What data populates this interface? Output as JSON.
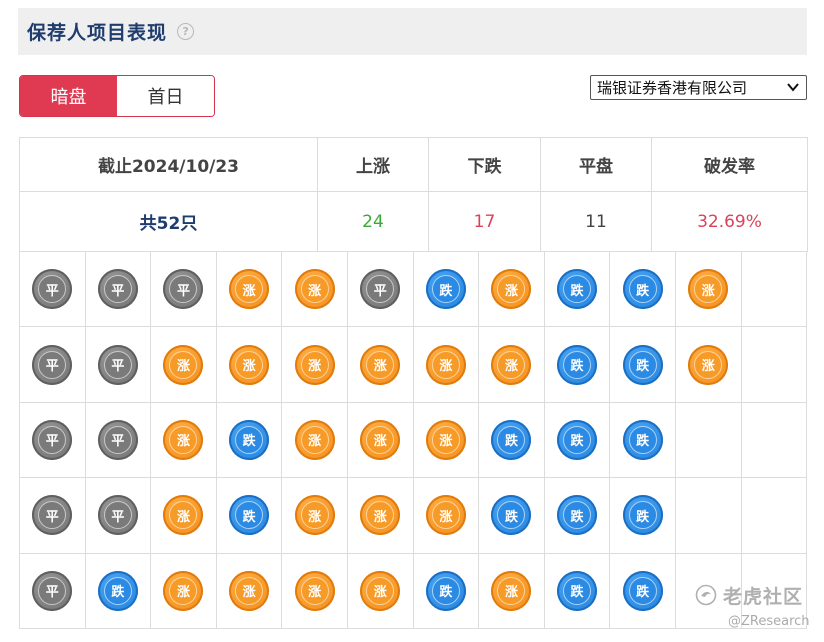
{
  "header": {
    "title": "保荐人项目表现",
    "help_symbol": "?"
  },
  "tabs": [
    {
      "label": "暗盘",
      "active": true
    },
    {
      "label": "首日",
      "active": false
    }
  ],
  "broker_select": {
    "selected": "瑞银证券香港有限公司"
  },
  "summary": {
    "headers": {
      "date": "截止2024/10/23",
      "up": "上涨",
      "down": "下跌",
      "flat": "平盘",
      "break_rate": "破发率"
    },
    "values": {
      "total": "共52只",
      "up": "24",
      "down": "17",
      "flat": "11",
      "break_rate": "32.69%"
    }
  },
  "coin_labels": {
    "flat": "平",
    "up": "涨",
    "down": "跌"
  },
  "colors": {
    "accent_red": "#e03a52",
    "up_orange": "#f28a16",
    "down_blue": "#1f7fdc",
    "flat_gray": "#7a7a7a",
    "up_value_green": "#3ba935",
    "down_value_red": "#d9435a"
  },
  "grid_rows": [
    [
      "flat",
      "flat",
      "flat",
      "up",
      "up",
      "flat",
      "down",
      "up",
      "down",
      "down",
      "up",
      ""
    ],
    [
      "flat",
      "flat",
      "up",
      "up",
      "up",
      "up",
      "up",
      "up",
      "down",
      "down",
      "up",
      ""
    ],
    [
      "flat",
      "flat",
      "up",
      "down",
      "up",
      "up",
      "up",
      "down",
      "down",
      "down",
      "",
      ""
    ],
    [
      "flat",
      "flat",
      "up",
      "down",
      "up",
      "up",
      "up",
      "down",
      "down",
      "down",
      "",
      ""
    ],
    [
      "flat",
      "down",
      "up",
      "up",
      "up",
      "up",
      "down",
      "up",
      "down",
      "down",
      "",
      ""
    ]
  ],
  "watermark": {
    "text": "老虎社区",
    "handle": "@ZResearch"
  }
}
